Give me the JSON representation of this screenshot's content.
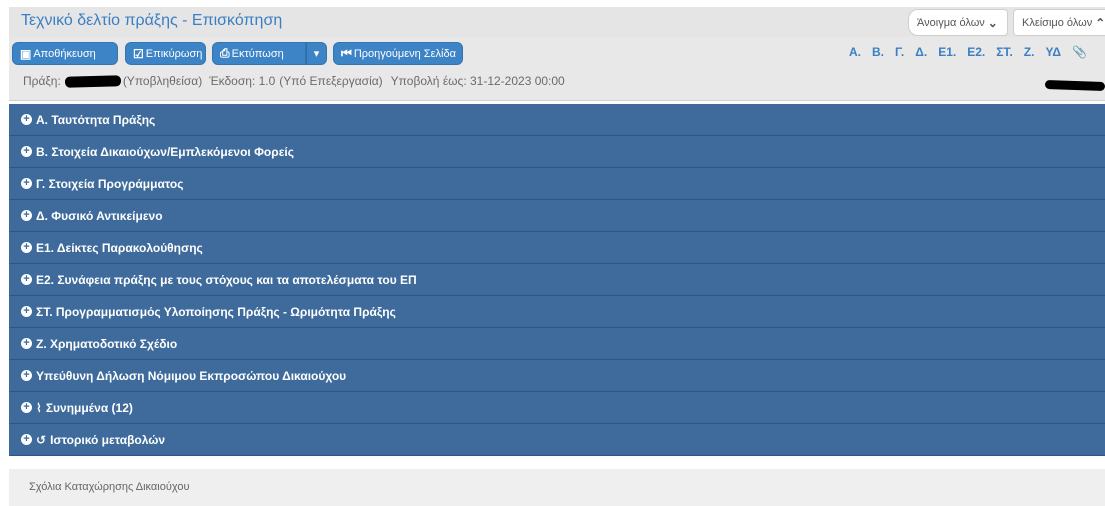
{
  "header": {
    "title": "Τεχνικό δελτίο πράξης - Επισκόπηση",
    "open_all": "Άνοιγμα όλων",
    "close_all": "Κλείσιμο όλων"
  },
  "toolbar": {
    "save": "Αποθήκευση",
    "validate": "Επικύρωση",
    "print": "Εκτύπωση",
    "prev_page": "Προηγούμενη Σελίδα"
  },
  "nav_links": [
    "Α.",
    "Β.",
    "Γ.",
    "Δ.",
    "Ε1.",
    "Ε2.",
    "ΣΤ.",
    "Ζ.",
    "ΥΔ"
  ],
  "info": {
    "praxi_label": "Πράξη:",
    "status": "(Υποβληθείσα)",
    "version": "Έκδοση: 1.0",
    "version_status": "(Υπό Επεξεργασία)",
    "deadline": "Υποβολή έως: 31-12-2023 00:00"
  },
  "sections": [
    "Α. Ταυτότητα Πράξης",
    "Β. Στοιχεία Δικαιούχων/Εμπλεκόμενοι Φορείς",
    "Γ. Στοιχεία Προγράμματος",
    "Δ. Φυσικό Αντικείμενο",
    "Ε1. Δείκτες Παρακολούθησης",
    "Ε2. Συνάφεια πράξης με τους στόχους και τα αποτελέσματα του ΕΠ",
    "ΣΤ. Προγραμματισμός Υλοποίησης Πράξης - Ωριμότητα Πράξης",
    "Ζ. Χρηματοδοτικό Σχέδιο",
    "Υπεύθυνη Δήλωση Νόμιμου Εκπροσώπου Δικαιούχου",
    "Συνημμένα (12)",
    "Ιστορικό μεταβολών"
  ],
  "comments_label": "Σχόλια Καταχώρησης Δικαιούχου",
  "colors": {
    "accent": "#3d84c6",
    "panel": "#3e6b9c",
    "title": "#3a7fc4"
  }
}
